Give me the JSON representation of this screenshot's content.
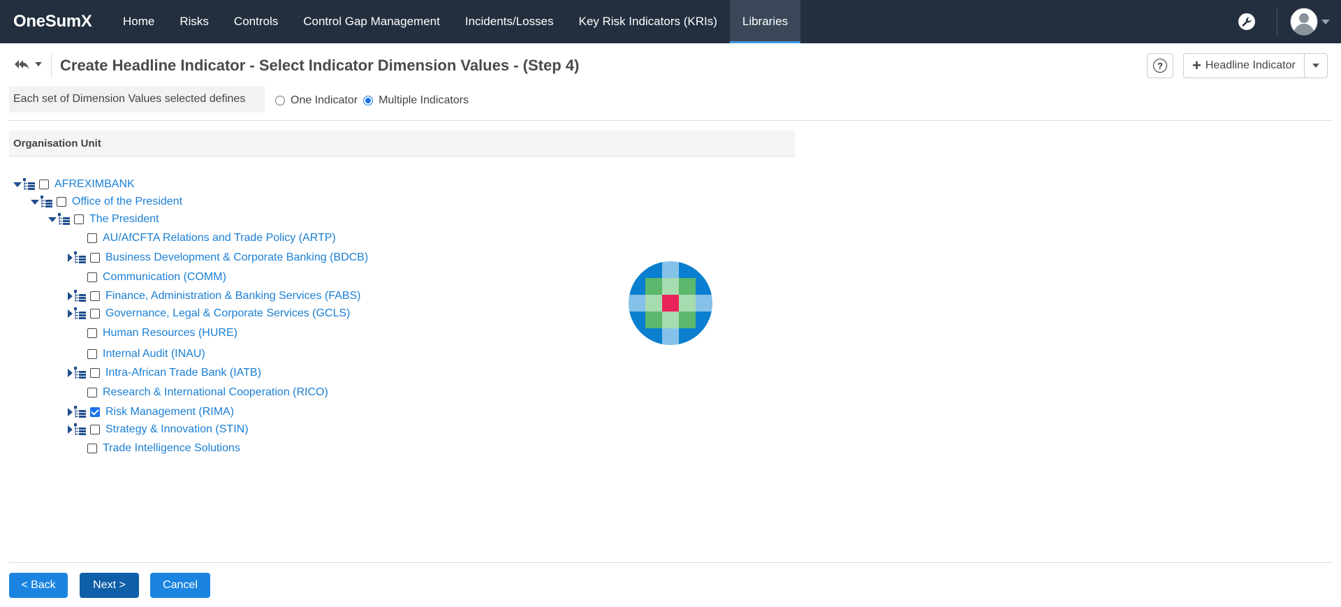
{
  "nav": {
    "brand": "OneSumX",
    "items": [
      {
        "label": "Home",
        "active": false
      },
      {
        "label": "Risks",
        "active": false
      },
      {
        "label": "Controls",
        "active": false
      },
      {
        "label": "Control Gap Management",
        "active": false
      },
      {
        "label": "Incidents/Losses",
        "active": false
      },
      {
        "label": "Key Risk Indicators (KRIs)",
        "active": false
      },
      {
        "label": "Libraries",
        "active": true
      }
    ],
    "icons": {
      "tools": "wrench-icon",
      "user": "user-avatar-icon"
    }
  },
  "header": {
    "title": "Create Headline Indicator - Select Indicator Dimension Values - (Step 4)",
    "help_label": "?",
    "add_button_label": "Headline Indicator"
  },
  "selection": {
    "define_label": "Each set of Dimension Values selected defines",
    "options": [
      {
        "label": "One Indicator",
        "checked": false
      },
      {
        "label": "Multiple Indicators",
        "checked": true
      }
    ]
  },
  "panel": {
    "header": "Organisation Unit"
  },
  "tree": [
    {
      "label": "AFREXIMBANK",
      "level": 0,
      "expander": "expanded",
      "has_icon": true,
      "checked": false
    },
    {
      "label": "Office of the President",
      "level": 1,
      "expander": "expanded",
      "has_icon": true,
      "checked": false
    },
    {
      "label": "The President",
      "level": 2,
      "expander": "expanded",
      "has_icon": true,
      "checked": false
    },
    {
      "label": "AU/AfCFTA Relations and Trade Policy (ARTP)",
      "level": 3,
      "expander": "none",
      "has_icon": false,
      "checked": false
    },
    {
      "label": "Business Development & Corporate Banking (BDCB)",
      "level": 3,
      "expander": "collapsed",
      "has_icon": true,
      "checked": false
    },
    {
      "label": "Communication (COMM)",
      "level": 3,
      "expander": "none",
      "has_icon": false,
      "checked": false
    },
    {
      "label": "Finance, Administration & Banking Services (FABS)",
      "level": 3,
      "expander": "collapsed",
      "has_icon": true,
      "checked": false
    },
    {
      "label": "Governance, Legal & Corporate Services (GCLS)",
      "level": 3,
      "expander": "collapsed",
      "has_icon": true,
      "checked": false
    },
    {
      "label": "Human Resources (HURE)",
      "level": 3,
      "expander": "none",
      "has_icon": false,
      "checked": false
    },
    {
      "label": "Internal Audit (INAU)",
      "level": 3,
      "expander": "none",
      "has_icon": false,
      "checked": false
    },
    {
      "label": "Intra-African Trade Bank (IATB)",
      "level": 3,
      "expander": "collapsed",
      "has_icon": true,
      "checked": false
    },
    {
      "label": "Research & International Cooperation (RICO)",
      "level": 3,
      "expander": "none",
      "has_icon": false,
      "checked": false
    },
    {
      "label": "Risk Management (RIMA)",
      "level": 3,
      "expander": "collapsed",
      "has_icon": true,
      "checked": true
    },
    {
      "label": "Strategy & Innovation (STIN)",
      "level": 3,
      "expander": "collapsed",
      "has_icon": true,
      "checked": false
    },
    {
      "label": "Trade Intelligence Solutions",
      "level": 3,
      "expander": "none",
      "has_icon": false,
      "checked": false
    }
  ],
  "footer": {
    "back_label": "< Back",
    "next_label": "Next >",
    "cancel_label": "Cancel"
  },
  "colors": {
    "nav_bg": "#232f3e",
    "link": "#1a7fd4",
    "primary_button": "#1a84e0",
    "next_button": "#0f5ea8"
  }
}
